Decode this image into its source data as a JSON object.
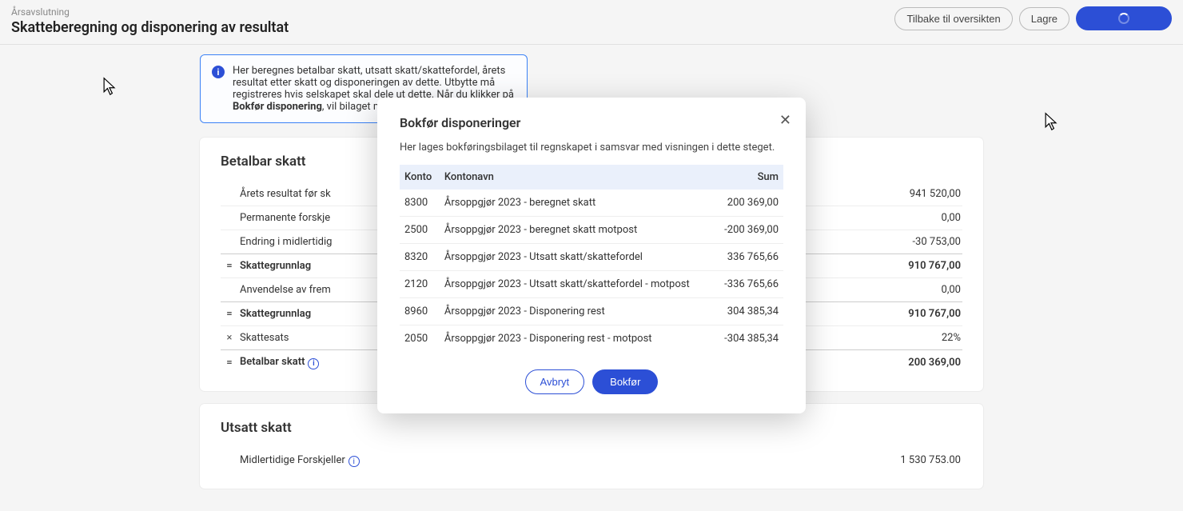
{
  "header": {
    "breadcrumb": "Årsavslutning",
    "title": "Skatteberegning og disponering av resultat",
    "actions": {
      "back": "Tilbake til oversikten",
      "save": "Lagre"
    }
  },
  "info_box": {
    "text_before": "Her beregnes betalbar skatt, utsatt skatt/skattefordel, årets resultat etter skatt og disponeringen av dette. Utbytte må registreres hvis selskapet skal dele ut dette. Når du klikker på ",
    "bold": "Bokfør disponering",
    "text_after": ", vil bilaget med skatt og"
  },
  "section_betalbar": {
    "title": "Betalbar skatt",
    "rows": [
      {
        "op": "",
        "label": "Årets resultat før sk",
        "value": "941 520,00"
      },
      {
        "op": "",
        "label": "Permanente forskje",
        "value": "0,00"
      },
      {
        "op": "",
        "label": "Endring i midlertidig",
        "value": "-30 753,00"
      },
      {
        "op": "=",
        "label": "Skattegrunnlag",
        "value": "910 767,00",
        "emph": true
      },
      {
        "op": "",
        "label": "Anvendelse av frem",
        "value": "0,00"
      },
      {
        "op": "=",
        "label": "Skattegrunnlag",
        "value": "910 767,00",
        "emph": true
      },
      {
        "op": "×",
        "label": "Skattesats",
        "value": "22%"
      },
      {
        "op": "=",
        "label": "Betalbar skatt",
        "value": "200 369,00",
        "emph": true,
        "info": true
      }
    ]
  },
  "section_utsatt": {
    "title": "Utsatt skatt",
    "rows": [
      {
        "op": "",
        "label": "Midlertidige Forskjeller",
        "value": "1 530 753.00",
        "info": true
      }
    ]
  },
  "modal": {
    "title": "Bokfør disponeringer",
    "description": "Her lages bokføringsbilaget til regnskapet i samsvar med visningen i dette steget.",
    "columns": {
      "konto": "Konto",
      "kontonavn": "Kontonavn",
      "sum": "Sum"
    },
    "rows": [
      {
        "konto": "8300",
        "navn": "Årsoppgjør 2023 - beregnet skatt",
        "sum": "200 369,00"
      },
      {
        "konto": "2500",
        "navn": "Årsoppgjør 2023 - beregnet skatt motpost",
        "sum": "-200 369,00"
      },
      {
        "konto": "8320",
        "navn": "Årsoppgjør 2023 - Utsatt skatt/skattefordel",
        "sum": "336 765,66"
      },
      {
        "konto": "2120",
        "navn": "Årsoppgjør 2023 - Utsatt skatt/skattefordel - motpost",
        "sum": "-336 765,66"
      },
      {
        "konto": "8960",
        "navn": "Årsoppgjør 2023 - Disponering rest",
        "sum": "304 385,34"
      },
      {
        "konto": "2050",
        "navn": "Årsoppgjør 2023 - Disponering rest - motpost",
        "sum": "-304 385,34"
      }
    ],
    "actions": {
      "cancel": "Avbryt",
      "confirm": "Bokfør"
    }
  }
}
